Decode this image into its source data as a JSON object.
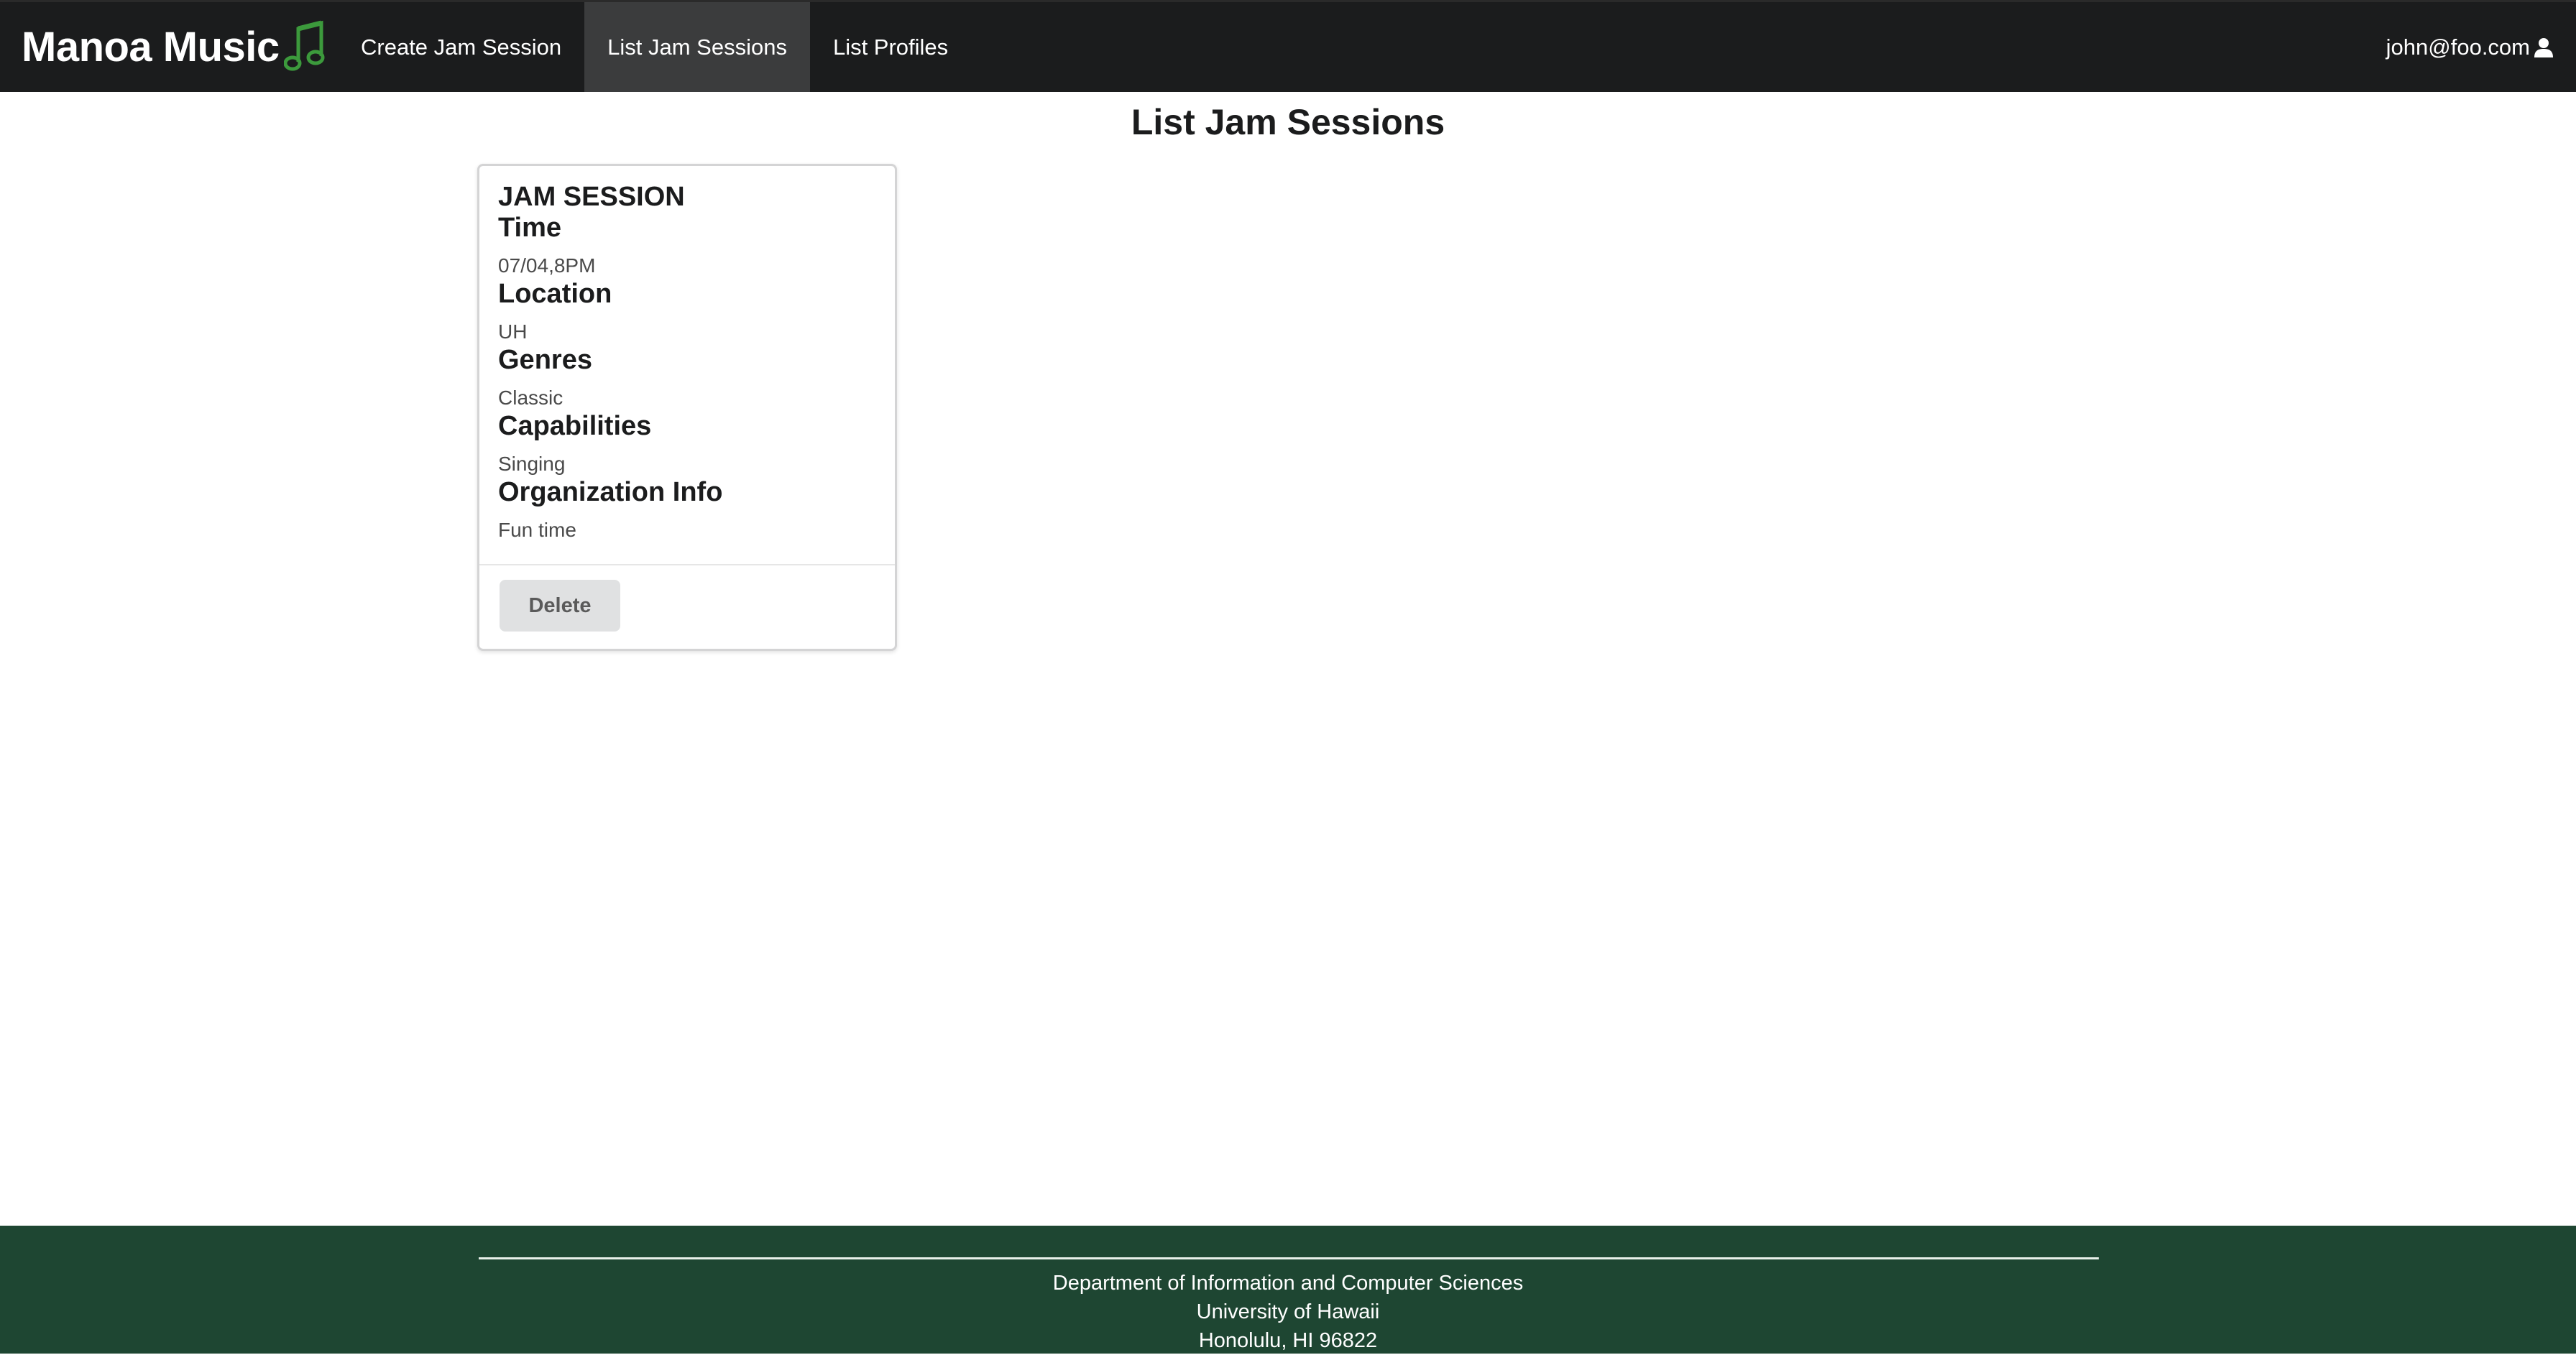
{
  "navbar": {
    "brand": "Manoa Music",
    "brand_icon": "music-note-icon",
    "items": [
      {
        "label": "Create Jam Session",
        "active": false
      },
      {
        "label": "List Jam Sessions",
        "active": true
      },
      {
        "label": "List Profiles",
        "active": false
      }
    ],
    "user_email": "john@foo.com",
    "user_icon": "user-icon"
  },
  "page": {
    "title": "List Jam Sessions"
  },
  "cards": [
    {
      "header": "JAM SESSION",
      "fields": [
        {
          "label": "Time",
          "value": "07/04,8PM"
        },
        {
          "label": "Location",
          "value": "UH"
        },
        {
          "label": "Genres",
          "value": "Classic"
        },
        {
          "label": "Capabilities",
          "value": "Singing"
        },
        {
          "label": "Organization Info",
          "value": "Fun time"
        }
      ],
      "delete_label": "Delete"
    }
  ],
  "footer": {
    "lines": [
      "Department of Information and Computer Sciences",
      "University of Hawaii",
      "Honolulu, HI 96822"
    ]
  },
  "colors": {
    "navbar_bg": "#1b1c1d",
    "active_item_bg": "#3b3c3d",
    "brand_icon": "#3c9a3c",
    "footer_bg": "#1e4632"
  }
}
